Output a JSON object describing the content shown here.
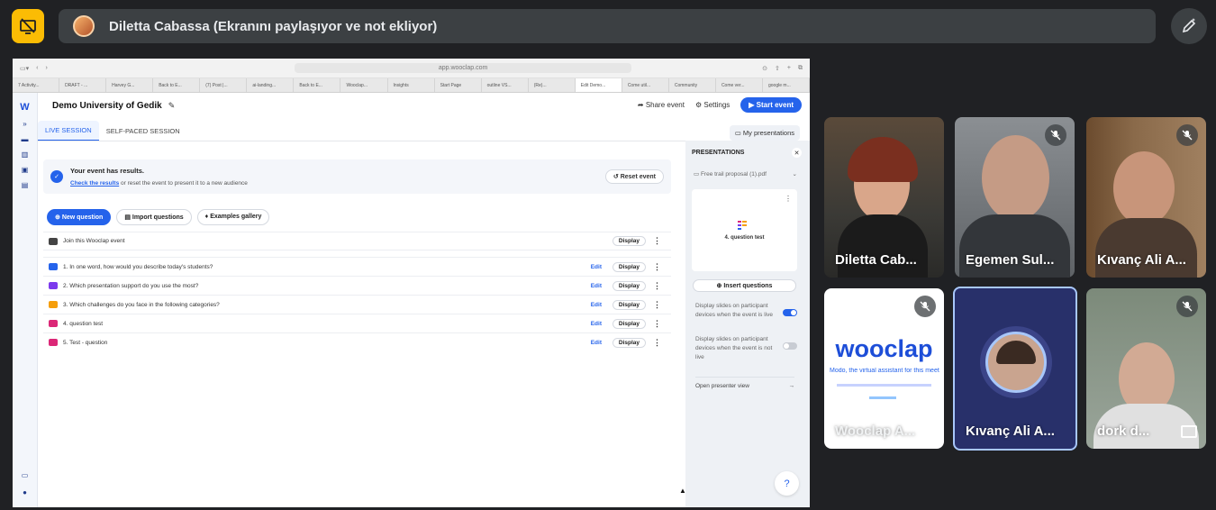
{
  "banner": {
    "text": "Diletta Cabassa (Ekranını paylaşıyor ve not ekliyor)"
  },
  "browser": {
    "url": "app.wooclap.com",
    "tabs": [
      "7 Activity...",
      "DRAFT - ...",
      "Harvey G...",
      "Back to E...",
      "(7) Post |...",
      "ai-landing...",
      "Back to E...",
      "Wooclap...",
      "Insights",
      "Start Page",
      "outline VS...",
      "(Re)...",
      "Edit Demo...",
      "Come util...",
      "Community",
      "Come ver...",
      "google m..."
    ],
    "active_tab_index": 12
  },
  "app": {
    "event_title": "Demo University of Gedik",
    "share_label": "Share event",
    "settings_label": "Settings",
    "start_label": "Start event",
    "tabs": [
      "LIVE SESSION",
      "SELF-PACED SESSION"
    ],
    "my_presentations": "My presentations",
    "notice": {
      "title": "Your event has results.",
      "link": "Check the results",
      "rest": " or reset the event to present it to a new audience",
      "reset_label": "Reset event"
    },
    "actions": {
      "new_question": "New question",
      "import_questions": "Import questions",
      "examples_gallery": "Examples gallery"
    },
    "join_row": {
      "label": "Join this Wooclap event",
      "display": "Display"
    },
    "edit_label": "Edit",
    "display_label": "Display",
    "questions": [
      {
        "text": "1. In one word, how would you describe today's students?",
        "color": "#2563eb"
      },
      {
        "text": "2. Which presentation support do you use the most?",
        "color": "#7c3aed"
      },
      {
        "text": "3. Which challenges do you face in the following categories?",
        "color": "#f59e0b"
      },
      {
        "text": "4. question test",
        "color": "#db2777"
      },
      {
        "text": "5. Test - question",
        "color": "#db2777"
      }
    ]
  },
  "panel": {
    "title": "PRESENTATIONS",
    "file": "Free trail proposal (1).pdf",
    "slide_title": "4. question test",
    "insert_label": "Insert questions",
    "toggle_live": {
      "label": "Display slides on participant devices when the event is live",
      "on": true
    },
    "toggle_not_live": {
      "label": "Display slides on participant devices when the event is not live",
      "on": false
    },
    "presenter_view": "Open presenter view",
    "help": "?"
  },
  "participants": [
    {
      "name": "Diletta Cab...",
      "muted": false
    },
    {
      "name": "Egemen Sul...",
      "muted": true
    },
    {
      "name": "Kıvanç Ali A...",
      "muted": true
    },
    {
      "name": "Wooclap A...",
      "muted": true,
      "slide_brand": "wooclap",
      "slide_tagline": "Modo, the virtual assistant for this meet"
    },
    {
      "name": "Kıvanç Ali A...",
      "muted": false
    },
    {
      "name": "dork d...",
      "muted": true
    }
  ],
  "colors": {
    "accent": "#2563eb",
    "pin": "#fbbc04",
    "active_tile_border": "#a8c7fa"
  }
}
